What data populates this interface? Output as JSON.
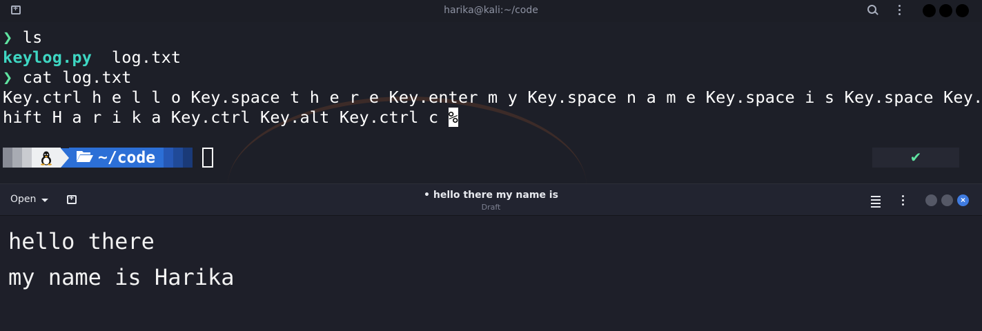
{
  "terminal": {
    "title": "harika@kali:~/code",
    "lines": {
      "cmd1": "ls",
      "file1": "keylog.py",
      "file2": "log.txt",
      "cmd2": "cat log.txt",
      "out1": "Key.ctrl h e l l o Key.space t h e r e Key.enter m y Key.space n a m e Key.space i s Key.space Key.s",
      "out2": "hift H a r i k a Key.ctrl Key.alt Key.ctrl c ",
      "out2_cursor": "%"
    },
    "prompt_symbol": "❯",
    "powerline": {
      "os_icon": "linux-icon",
      "folder_icon": "folder-open-icon",
      "dir": "~/code"
    },
    "status_right": "✔"
  },
  "editor": {
    "open_label": "Open",
    "title": "• hello there my name is",
    "subtitle": "Draft",
    "content": [
      "hello there",
      "my name is Harika"
    ]
  }
}
